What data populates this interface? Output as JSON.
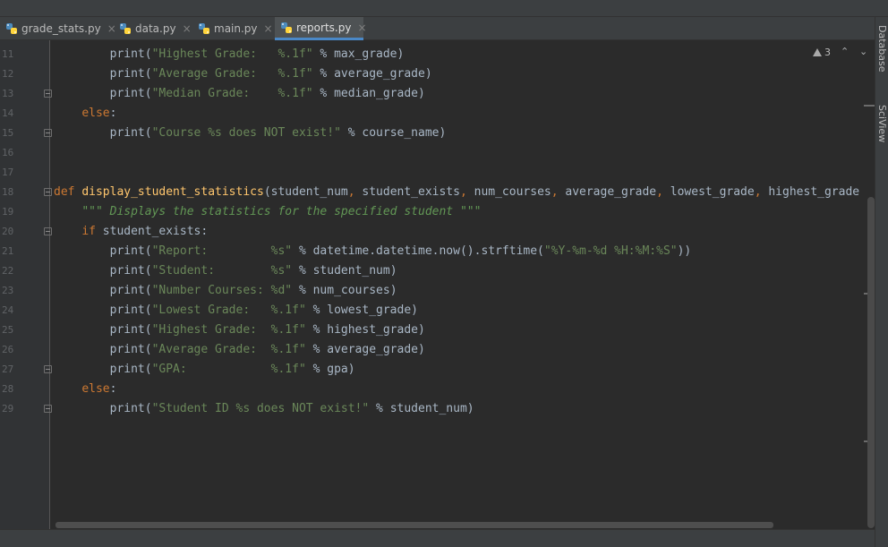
{
  "tabs": [
    {
      "label": "grade_stats.py",
      "active": false
    },
    {
      "label": "data.py",
      "active": false
    },
    {
      "label": "main.py",
      "active": false
    },
    {
      "label": "reports.py",
      "active": true
    }
  ],
  "tab_close_glyph": "×",
  "right_sidebar": {
    "items": [
      "Database",
      "SciView"
    ]
  },
  "inspection": {
    "warning_count": "3",
    "icon": "warning-icon"
  },
  "colors": {
    "editor_bg": "#2b2b2b",
    "keyword": "#cc7832",
    "function": "#ffc66d",
    "string": "#6a8759",
    "docstring": "#629755",
    "text": "#a9b7c6",
    "line_number": "#606366",
    "active_tab_underline": "#4a88c7"
  },
  "code": {
    "line_numbers": [
      "11",
      "12",
      "13",
      "14",
      "15",
      "16",
      "17",
      "18",
      "19",
      "20",
      "21",
      "22",
      "23",
      "24",
      "25",
      "26",
      "27",
      "28",
      "29"
    ],
    "lines": [
      "        print(\"Highest Grade:   %.1f\" % max_grade)",
      "        print(\"Average Grade:   %.1f\" % average_grade)",
      "        print(\"Median Grade:    %.1f\" % median_grade)",
      "    else:",
      "        print(\"Course %s does NOT exist!\" % course_name)",
      "",
      "",
      "def display_student_statistics(student_num, student_exists, num_courses, average_grade, lowest_grade, highest_grade",
      "    \"\"\" Displays the statistics for the specified student \"\"\"",
      "    if student_exists:",
      "        print(\"Report:         %s\" % datetime.datetime.now().strftime(\"%Y-%m-%d %H:%M:%S\"))",
      "        print(\"Student:        %s\" % student_num)",
      "        print(\"Number Courses: %d\" % num_courses)",
      "        print(\"Lowest Grade:   %.1f\" % lowest_grade)",
      "        print(\"Highest Grade:  %.1f\" % highest_grade)",
      "        print(\"Average Grade:  %.1f\" % average_grade)",
      "        print(\"GPA:            %.1f\" % gpa)",
      "    else:",
      "        print(\"Student ID %s does NOT exist!\" % student_num)"
    ]
  }
}
